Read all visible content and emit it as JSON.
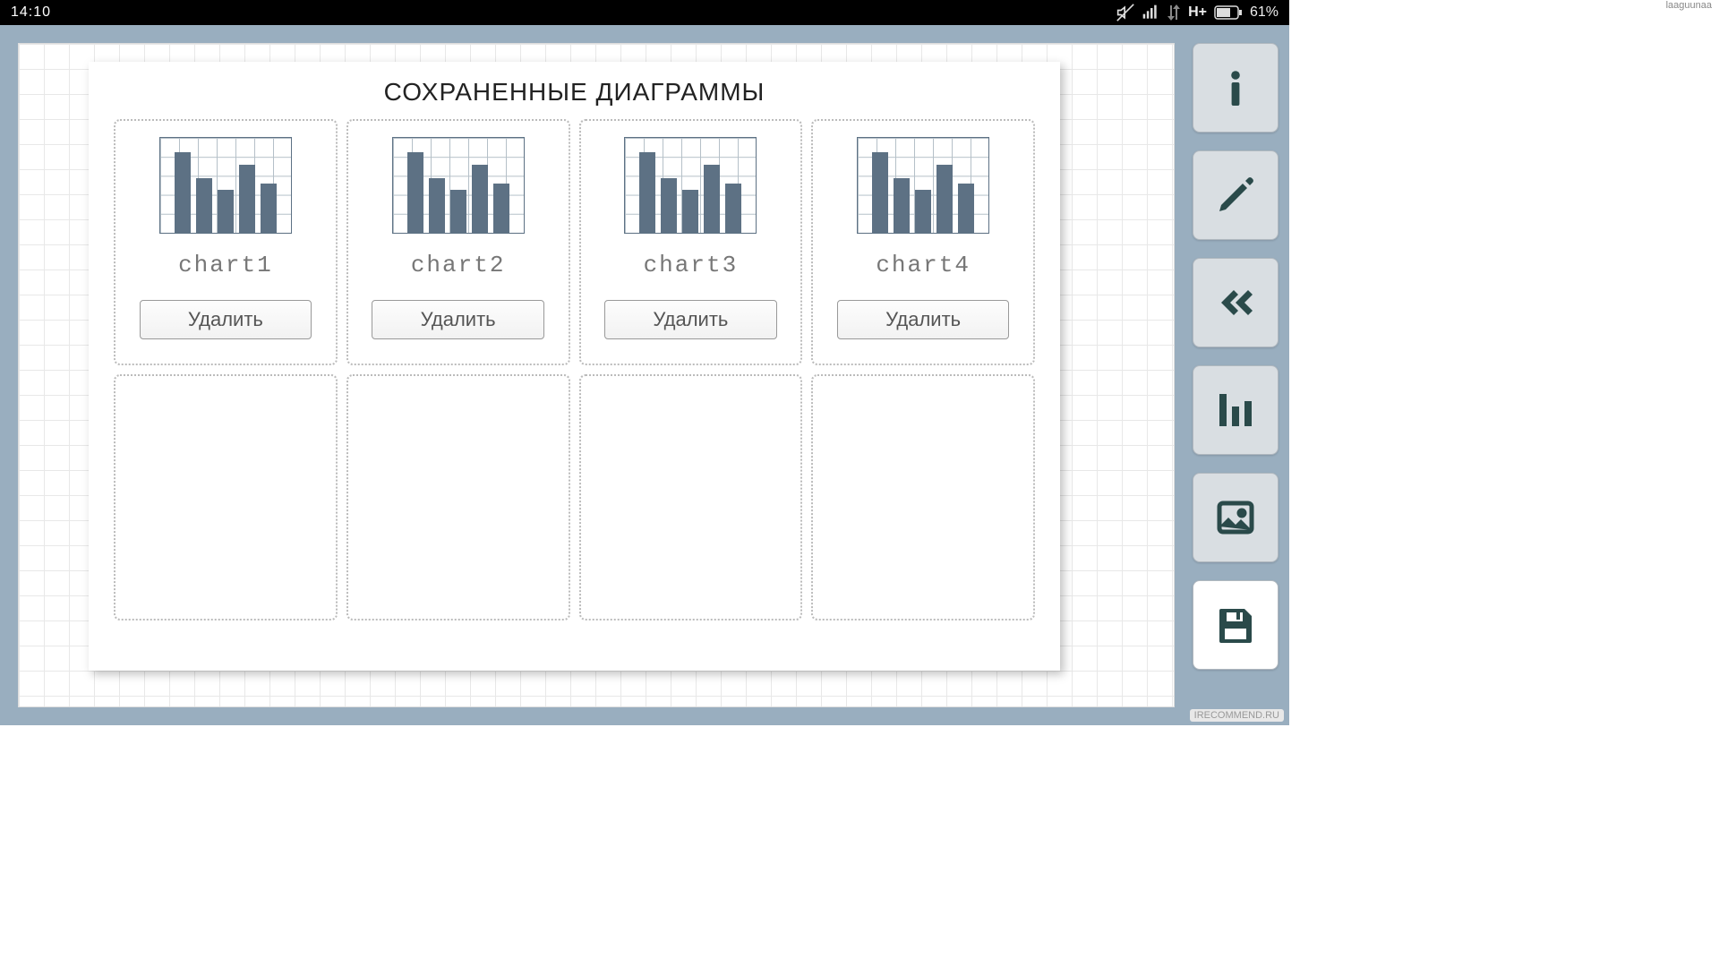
{
  "status": {
    "time": "14:10",
    "network": "H+",
    "battery": "61%",
    "watermark_top": "laaguunaa"
  },
  "dialog": {
    "title": "СОХРАНЕННЫЕ ДИАГРАММЫ",
    "charts": [
      {
        "name": "chart1",
        "delete_label": "Удалить"
      },
      {
        "name": "chart2",
        "delete_label": "Удалить"
      },
      {
        "name": "chart3",
        "delete_label": "Удалить"
      },
      {
        "name": "chart4",
        "delete_label": "Удалить"
      }
    ]
  },
  "toolbar": {
    "info_icon": "info",
    "edit_icon": "pencil",
    "back_icon": "chevrons-left",
    "chart_icon": "bar-chart",
    "image_icon": "image",
    "save_icon": "floppy"
  },
  "watermark_bottom": "IRECOMMEND.RU",
  "colors": {
    "app_bg": "#99aebf",
    "icon": "#2a4a4a",
    "bar": "#5d7184"
  }
}
